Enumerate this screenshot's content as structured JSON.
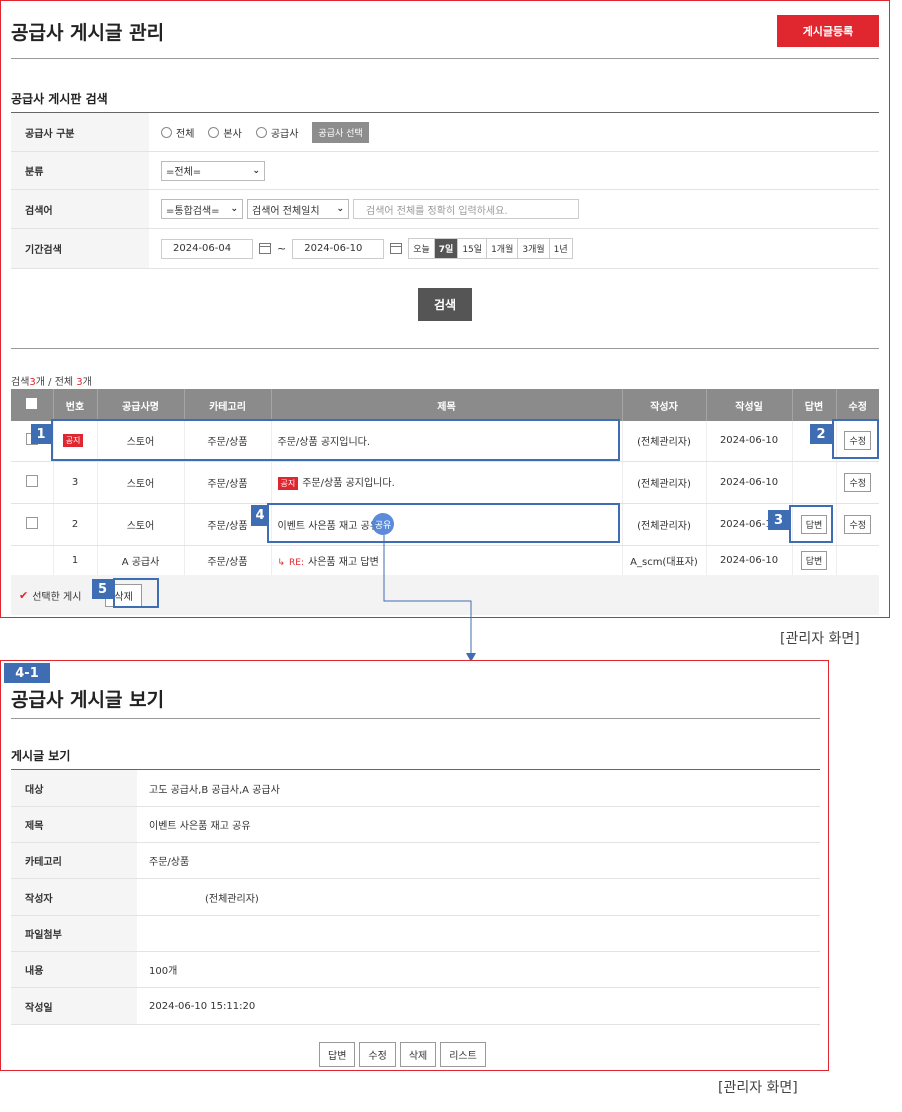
{
  "admin": {
    "page_title": "공급사 게시글 관리",
    "register_button": "게시글등록",
    "search_section_title": "공급사 게시판 검색",
    "search": {
      "supplier_type_label": "공급사 구분",
      "radio_all": "전체",
      "radio_hq": "본사",
      "radio_supplier": "공급사",
      "supplier_select_button": "공급사 선택",
      "category_label": "분류",
      "category_value": "=전체=",
      "keyword_label": "검색어",
      "keyword_type": "=통합검색=",
      "keyword_match": "검색어 전체일치",
      "keyword_placeholder": "검색어 전체를 정확히 입력하세요.",
      "period_label": "기간검색",
      "date_from": "2024-06-04",
      "date_sep": "~",
      "date_to": "2024-06-10",
      "period_buttons": [
        "오늘",
        "7일",
        "15일",
        "1개월",
        "3개월",
        "1년"
      ],
      "period_active": "7일",
      "search_button": "검색"
    },
    "count": {
      "prefix": "검색",
      "found": "3",
      "mid": "개 / 전체 ",
      "total": "3",
      "suffix": "개"
    },
    "table": {
      "headers": [
        "번호",
        "공급사명",
        "카테고리",
        "제목",
        "작성자",
        "작성일",
        "답변",
        "수정"
      ],
      "rows": [
        {
          "no": "공지",
          "supplier": "스토어",
          "category": "주문/상품",
          "title": "주문/상품 공지입니다.",
          "writer": "(전체관리자)",
          "date": "2024-06-10",
          "reply": "",
          "edit": "수정"
        },
        {
          "no": "3",
          "supplier": "스토어",
          "category": "주문/상품",
          "badge": "공지",
          "title": "주문/상품 공지입니다.",
          "writer": "(전체관리자)",
          "date": "2024-06-10",
          "reply": "",
          "edit": "수정"
        },
        {
          "no": "2",
          "supplier": "스토어",
          "category": "주문/상품",
          "title": "이벤트 사은품 재고 공유",
          "writer": "(전체관리자)",
          "date": "2024-06-10",
          "reply": "답변",
          "edit": "수정"
        },
        {
          "no": "1",
          "supplier": "A 공급사",
          "category": "주문/상품",
          "re": "RE:",
          "title": "사은품 재고 답변",
          "writer": "A_scm(대표자)",
          "date": "2024-06-10",
          "reply": "답변",
          "edit": ""
        }
      ]
    },
    "selected_label": "선택한 게시",
    "delete_button": "삭제",
    "caption": "[관리자 화면]"
  },
  "callouts": {
    "n1": "1",
    "n2": "2",
    "n3": "3",
    "n4": "4",
    "n5": "5",
    "n41": "4-1",
    "cursor_text": "공유"
  },
  "view": {
    "page_title": "공급사 게시글 보기",
    "section_title": "게시글 보기",
    "rows": [
      {
        "label": "대상",
        "value": "고도 공급사,B 공급사,A 공급사"
      },
      {
        "label": "제목",
        "value": "이벤트 사은품 재고 공유"
      },
      {
        "label": "카테고리",
        "value": "주문/상품"
      },
      {
        "label": "작성자",
        "value": "(전체관리자)"
      },
      {
        "label": "파일첨부",
        "value": ""
      },
      {
        "label": "내용",
        "value": "100개"
      },
      {
        "label": "작성일",
        "value": "2024-06-10 15:11:20"
      }
    ],
    "buttons": {
      "reply": "답변",
      "edit": "수정",
      "delete": "삭제",
      "list": "리스트"
    },
    "caption": "[관리자 화면]"
  },
  "colors": {
    "accent": "#e0262e",
    "callout": "#3f6db3",
    "header_gray": "#8b8b8b"
  }
}
